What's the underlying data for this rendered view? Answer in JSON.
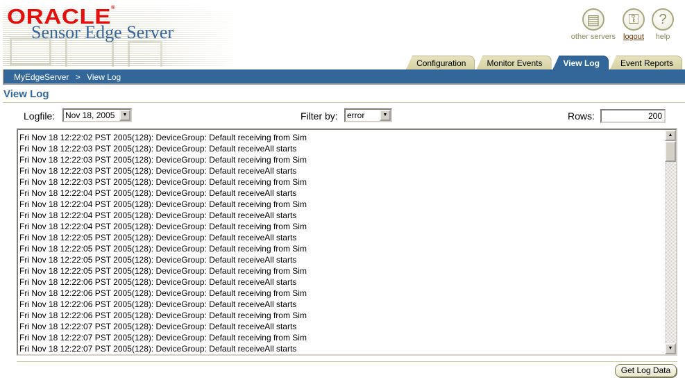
{
  "header": {
    "brand": "ORACLE",
    "brand_mark": "®",
    "product": "Sensor Edge Server"
  },
  "global_links": [
    {
      "label": "other servers",
      "icon": "servers-icon",
      "glyph": "▤"
    },
    {
      "label": "logout",
      "icon": "key-icon",
      "glyph": "⚿"
    },
    {
      "label": "help",
      "icon": "help-icon",
      "glyph": "?"
    }
  ],
  "tabs": [
    {
      "label": "Configuration",
      "active": false
    },
    {
      "label": "Monitor Events",
      "active": false
    },
    {
      "label": "View Log",
      "active": true
    },
    {
      "label": "Event Reports",
      "active": false
    }
  ],
  "breadcrumb": {
    "root": "MyEdgeServer",
    "separator": ">",
    "current": "View Log"
  },
  "page": {
    "title": "View Log"
  },
  "controls": {
    "logfile_label": "Logfile:",
    "logfile_value": "Nov 18, 2005",
    "filter_label": "Filter by:",
    "filter_value": "error",
    "rows_label": "Rows:",
    "rows_value": "200"
  },
  "log": {
    "lines": [
      "Fri Nov 18 12:22:02 PST 2005(128): DeviceGroup: Default receiving from Sim",
      "Fri Nov 18 12:22:03 PST 2005(128): DeviceGroup: Default receiveAll starts",
      "Fri Nov 18 12:22:03 PST 2005(128): DeviceGroup: Default receiving from Sim",
      "Fri Nov 18 12:22:03 PST 2005(128): DeviceGroup: Default receiveAll starts",
      "Fri Nov 18 12:22:03 PST 2005(128): DeviceGroup: Default receiving from Sim",
      "Fri Nov 18 12:22:04 PST 2005(128): DeviceGroup: Default receiveAll starts",
      "Fri Nov 18 12:22:04 PST 2005(128): DeviceGroup: Default receiving from Sim",
      "Fri Nov 18 12:22:04 PST 2005(128): DeviceGroup: Default receiveAll starts",
      "Fri Nov 18 12:22:04 PST 2005(128): DeviceGroup: Default receiving from Sim",
      "Fri Nov 18 12:22:05 PST 2005(128): DeviceGroup: Default receiveAll starts",
      "Fri Nov 18 12:22:05 PST 2005(128): DeviceGroup: Default receiving from Sim",
      "Fri Nov 18 12:22:05 PST 2005(128): DeviceGroup: Default receiveAll starts",
      "Fri Nov 18 12:22:05 PST 2005(128): DeviceGroup: Default receiving from Sim",
      "Fri Nov 18 12:22:06 PST 2005(128): DeviceGroup: Default receiveAll starts",
      "Fri Nov 18 12:22:06 PST 2005(128): DeviceGroup: Default receiving from Sim",
      "Fri Nov 18 12:22:06 PST 2005(128): DeviceGroup: Default receiveAll starts",
      "Fri Nov 18 12:22:06 PST 2005(128): DeviceGroup: Default receiving from Sim",
      "Fri Nov 18 12:22:07 PST 2005(128): DeviceGroup: Default receiveAll starts",
      "Fri Nov 18 12:22:07 PST 2005(128): DeviceGroup: Default receiving from Sim",
      "Fri Nov 18 12:22:07 PST 2005(128): DeviceGroup: Default receiveAll starts"
    ]
  },
  "actions": {
    "get_log_data": "Get Log Data"
  },
  "colors": {
    "brand_red": "#e4100e",
    "primary_blue": "#336699",
    "tab_khaki": "#d5d1a4",
    "link_olive": "#8d8b5f"
  }
}
